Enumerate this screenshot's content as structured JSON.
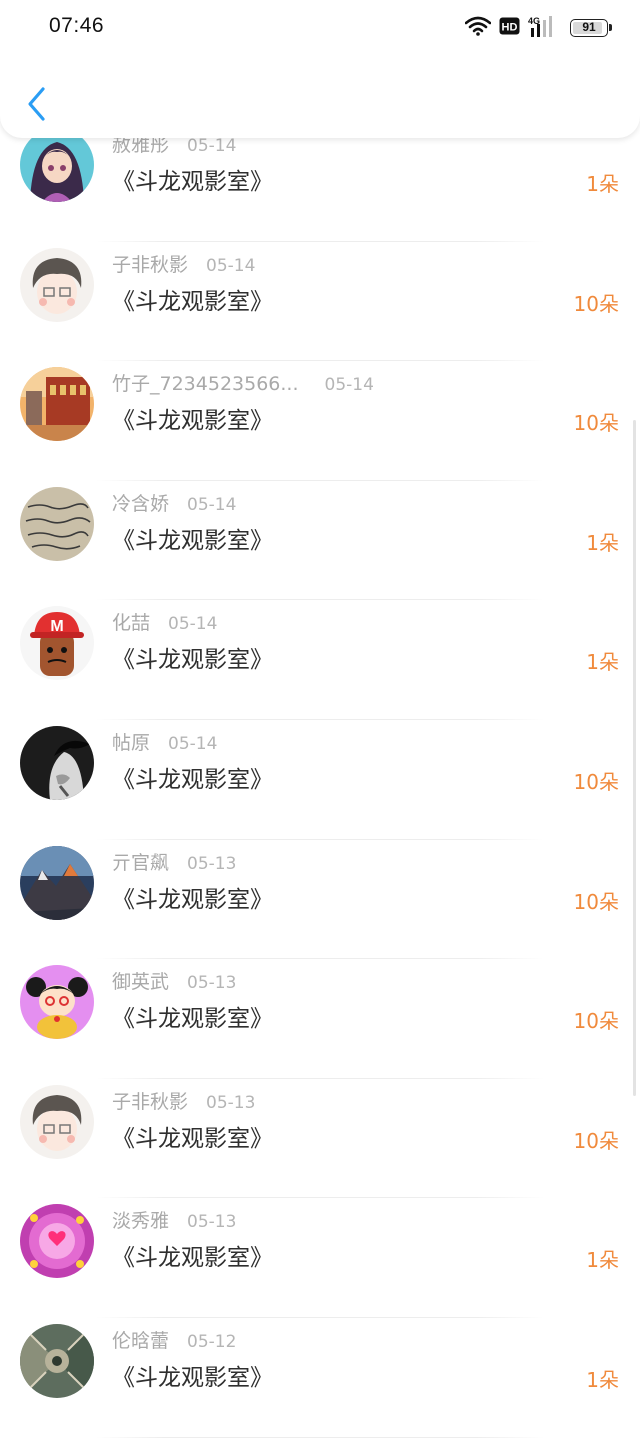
{
  "status_bar": {
    "time": "07:46",
    "icons": [
      "wifi-icon",
      "hd-icon",
      "4g-signal-icon",
      "battery-icon"
    ],
    "network_label": "4G",
    "hd_label": "HD",
    "battery_percent": 91
  },
  "header": {
    "back_icon": "chevron-left-icon",
    "accent_color": "#2a9df4"
  },
  "colors": {
    "amount": "#f08a3c",
    "name": "#a9a9a9",
    "title": "#2f2f2f"
  },
  "list": {
    "items": [
      {
        "name": "赦雅彤",
        "date": "05-14",
        "title": "《斗龙观影室》",
        "amount": "1朵",
        "avatar": "anime-girl-avatar"
      },
      {
        "name": "子非秋影",
        "date": "05-14",
        "title": "《斗龙观影室》",
        "amount": "10朵",
        "avatar": "cartoon-boy-avatar"
      },
      {
        "name": "竹子_7234523566...",
        "date": "05-14",
        "title": "《斗龙观影室》",
        "amount": "10朵",
        "avatar": "building-photo-avatar"
      },
      {
        "name": "冷含娇",
        "date": "05-14",
        "title": "《斗龙观影室》",
        "amount": "1朵",
        "avatar": "handwriting-avatar"
      },
      {
        "name": "化喆",
        "date": "05-14",
        "title": "《斗龙观影室》",
        "amount": "1朵",
        "avatar": "red-cap-figure-avatar"
      },
      {
        "name": "帖原",
        "date": "05-14",
        "title": "《斗龙观影室》",
        "amount": "10朵",
        "avatar": "bw-portrait-avatar"
      },
      {
        "name": "亓官飙",
        "date": "05-13",
        "title": "《斗龙观影室》",
        "amount": "10朵",
        "avatar": "mountain-avatar"
      },
      {
        "name": "御英武",
        "date": "05-13",
        "title": "《斗龙观影室》",
        "amount": "10朵",
        "avatar": "cartoon-doll-avatar"
      },
      {
        "name": "子非秋影",
        "date": "05-13",
        "title": "《斗龙观影室》",
        "amount": "10朵",
        "avatar": "cartoon-boy-avatar"
      },
      {
        "name": "淡秀雅",
        "date": "05-13",
        "title": "《斗龙观影室》",
        "amount": "1朵",
        "avatar": "pink-hearts-avatar"
      },
      {
        "name": "伦晗蕾",
        "date": "05-12",
        "title": "《斗龙观影室》",
        "amount": "1朵",
        "avatar": "pattern-avatar"
      }
    ]
  }
}
